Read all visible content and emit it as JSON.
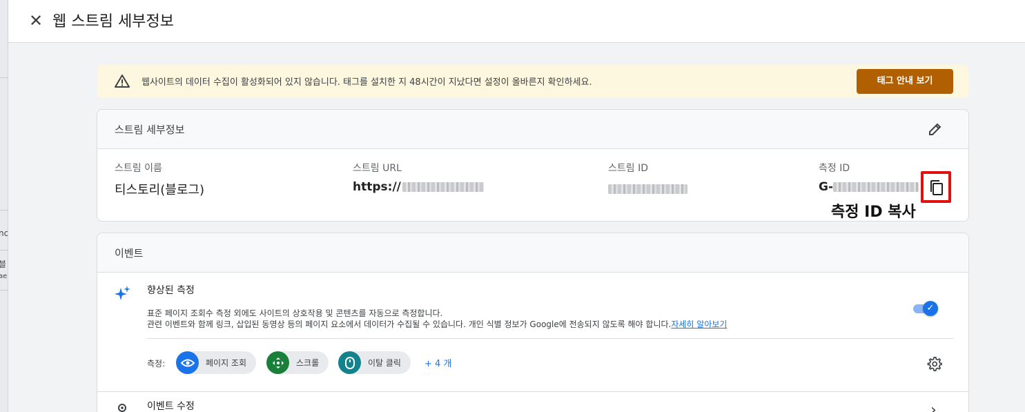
{
  "left_strip": {
    "fragments": [
      "nc",
      "블",
      "ae"
    ]
  },
  "header": {
    "close_icon": "close-icon",
    "title": "웹 스트림 세부정보"
  },
  "banner": {
    "icon": "warning-icon",
    "text": "웹사이트의 데이터 수집이 활성화되어 있지 않습니다. 태그를 설치한 지 48시간이 지났다면 설정이 올바른지 확인하세요.",
    "button_label": "태그 안내 보기",
    "button_color": "#b06000",
    "background": "#fef7e0"
  },
  "stream_details": {
    "title": "스트림 세부정보",
    "edit_icon": "pencil-icon",
    "fields": [
      {
        "label": "스트림 이름",
        "value": "티스토리(블로그)"
      },
      {
        "label": "스트림 URL",
        "value": "https://"
      },
      {
        "label": "스트림 ID",
        "value": ""
      },
      {
        "label": "측정 ID",
        "value": "G-"
      }
    ],
    "copy_icon": "copy-icon",
    "annotation": "측정 ID 복사",
    "highlight_color": "#e01010"
  },
  "events": {
    "title": "이벤트",
    "enhanced": {
      "icon": "sparkle-icon",
      "title": "향상된 측정",
      "desc_line1": "표준 페이지 조회수 측정 외에도 사이트의 상호작용 및 콘텐츠를 자동으로 측정합니다.",
      "desc_line2": "관련 이벤트와 함께 링크, 삽입된 동영상 등의 페이지 요소에서 데이터가 수집될 수 있습니다. 개인 식별 정보가 Google에 전송되지 않도록 해야 합니다.",
      "learn_more": "자세히 알아보기",
      "toggle_on": true,
      "measuring_label": "측정:",
      "chips": [
        {
          "label": "페이지 조회",
          "icon": "eye-icon",
          "color": "#1a73e8"
        },
        {
          "label": "스크롤",
          "icon": "scroll-arrows-icon",
          "color": "#188038"
        },
        {
          "label": "이탈 클릭",
          "icon": "mouse-icon",
          "color": "#12828c"
        }
      ],
      "more": "+ 4 개",
      "settings_icon": "gear-icon"
    },
    "modify": {
      "icon": "touch-icon",
      "title": "이벤트 수정",
      "chevron": "chevron-right-icon"
    }
  }
}
